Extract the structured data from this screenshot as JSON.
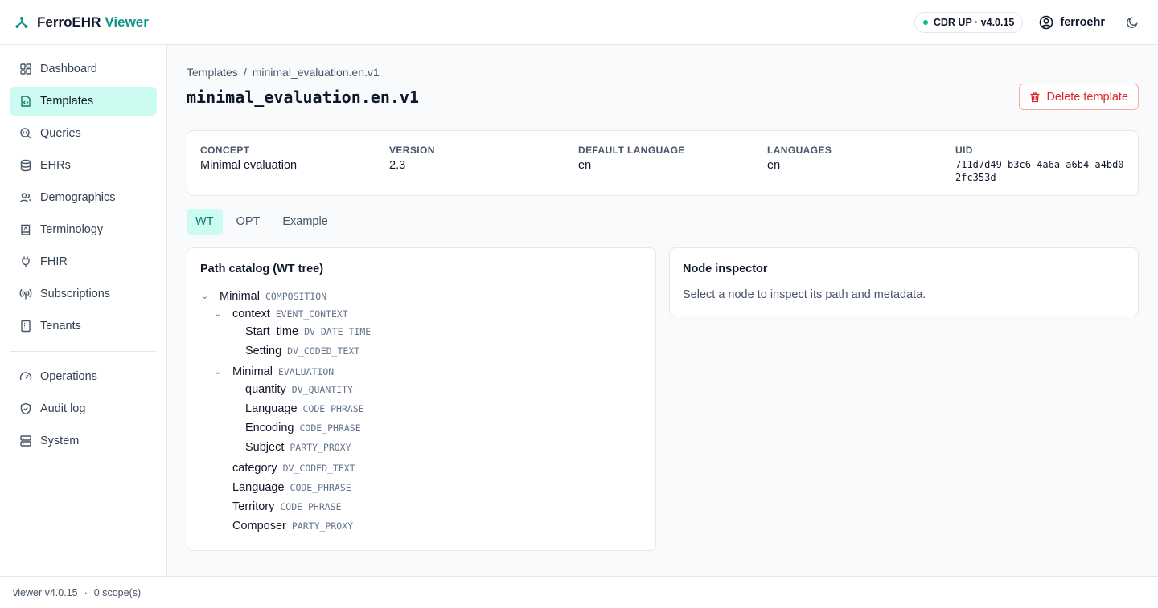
{
  "app": {
    "name": "FerroEHR",
    "name_accent": "Viewer"
  },
  "topbar": {
    "status": "CDR UP · v4.0.15",
    "user": "ferroehr"
  },
  "sidebar": {
    "items": [
      {
        "label": "Dashboard",
        "icon": "dashboard-icon"
      },
      {
        "label": "Templates",
        "icon": "file-code-icon"
      },
      {
        "label": "Queries",
        "icon": "search-code-icon"
      },
      {
        "label": "EHRs",
        "icon": "database-icon"
      },
      {
        "label": "Demographics",
        "icon": "users-icon"
      },
      {
        "label": "Terminology",
        "icon": "book-icon"
      },
      {
        "label": "FHIR",
        "icon": "plug-icon"
      },
      {
        "label": "Subscriptions",
        "icon": "radio-icon"
      },
      {
        "label": "Tenants",
        "icon": "building-icon"
      }
    ],
    "secondary": [
      {
        "label": "Operations",
        "icon": "gauge-icon"
      },
      {
        "label": "Audit log",
        "icon": "shield-icon"
      },
      {
        "label": "System",
        "icon": "server-icon"
      }
    ]
  },
  "breadcrumb": {
    "root": "Templates",
    "sep": "/",
    "current": "minimal_evaluation.en.v1"
  },
  "page": {
    "title": "minimal_evaluation.en.v1",
    "delete_label": "Delete template"
  },
  "meta": {
    "concept_label": "CONCEPT",
    "concept": "Minimal evaluation",
    "version_label": "VERSION",
    "version": "2.3",
    "default_language_label": "DEFAULT LANGUAGE",
    "default_language": "en",
    "languages_label": "LANGUAGES",
    "languages": "en",
    "uid_label": "UID",
    "uid": "711d7d49-b3c6-4a6a-a6b4-a4bd02fc353d"
  },
  "tabs": [
    "WT",
    "OPT",
    "Example"
  ],
  "catalog": {
    "title": "Path catalog (WT tree)",
    "nodes": [
      {
        "name": "Minimal",
        "type": "COMPOSITION",
        "expanded": true
      },
      {
        "name": "context",
        "type": "EVENT_CONTEXT",
        "expanded": true
      },
      {
        "name": "Start_time",
        "type": "DV_DATE_TIME"
      },
      {
        "name": "Setting",
        "type": "DV_CODED_TEXT"
      },
      {
        "name": "Minimal",
        "type": "EVALUATION",
        "expanded": true
      },
      {
        "name": "quantity",
        "type": "DV_QUANTITY"
      },
      {
        "name": "Language",
        "type": "CODE_PHRASE"
      },
      {
        "name": "Encoding",
        "type": "CODE_PHRASE"
      },
      {
        "name": "Subject",
        "type": "PARTY_PROXY"
      },
      {
        "name": "category",
        "type": "DV_CODED_TEXT"
      },
      {
        "name": "Language",
        "type": "CODE_PHRASE"
      },
      {
        "name": "Territory",
        "type": "CODE_PHRASE"
      },
      {
        "name": "Composer",
        "type": "PARTY_PROXY"
      }
    ]
  },
  "inspector": {
    "title": "Node inspector",
    "hint": "Select a node to inspect its path and metadata."
  },
  "footer": {
    "version": "viewer v4.0.15",
    "sep": "·",
    "scopes": "0 scope(s)"
  },
  "colors": {
    "accent": "#0d9488",
    "active_bg": "#ccfbf1",
    "danger": "#dc2626",
    "status_ok": "#10b981"
  }
}
